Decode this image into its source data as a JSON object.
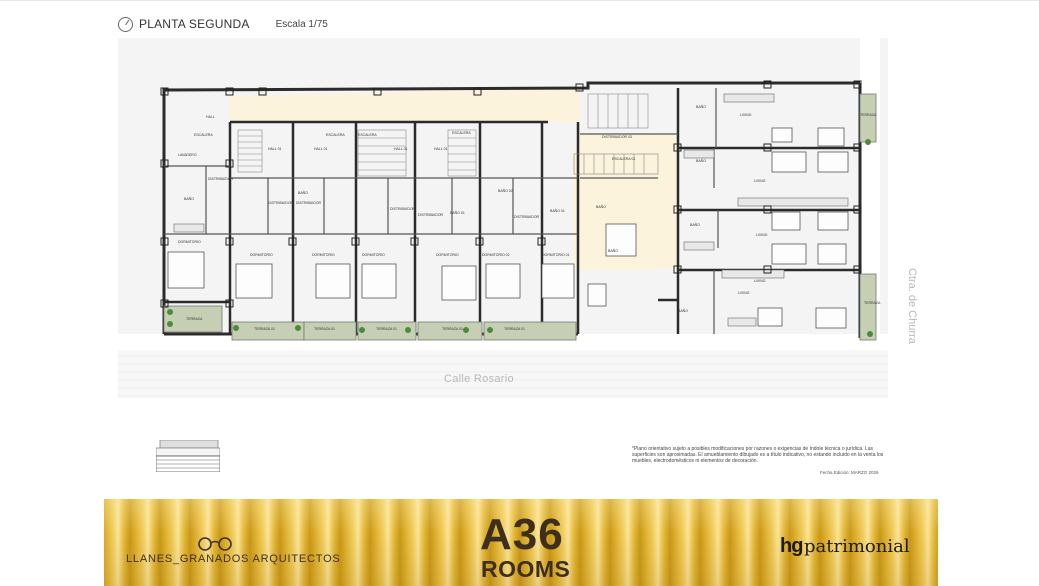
{
  "header": {
    "plan_title": "PLANTA SEGUNDA",
    "scale": "Escala 1/75"
  },
  "plan": {
    "street_label": "Calle Rosario",
    "road_label": "Ctra. de Churra",
    "rooms": [
      {
        "label": "HALL"
      },
      {
        "label": "ESCALERA"
      },
      {
        "label": "LAVADERO"
      },
      {
        "label": "BAÑO"
      },
      {
        "label": "DISTRIBUIDOR"
      },
      {
        "label": "DORMITORIO"
      },
      {
        "label": "TERRAZA"
      },
      {
        "label": "HALL 01"
      },
      {
        "label": "DISTRIBUIDOR"
      },
      {
        "label": "DORMITORIO"
      },
      {
        "label": "TERRAZA 01"
      },
      {
        "label": "ESCALERA"
      },
      {
        "label": "HALL 01"
      },
      {
        "label": "BAÑO"
      },
      {
        "label": "DISTRIBUIDOR"
      },
      {
        "label": "DORMITORIO"
      },
      {
        "label": "TERRAZA 01"
      },
      {
        "label": "ESCALERA"
      },
      {
        "label": "HALL 01"
      },
      {
        "label": "DISTRIBUIDOR"
      },
      {
        "label": "DORMITORIO"
      },
      {
        "label": "TERRAZA 01"
      },
      {
        "label": "ESCALERA"
      },
      {
        "label": "HALL 01"
      },
      {
        "label": "DISTRIBUIDOR"
      },
      {
        "label": "BAÑO 01"
      },
      {
        "label": "DORMITORIO"
      },
      {
        "label": "TERRAZA 01"
      },
      {
        "label": "BAÑO 02"
      },
      {
        "label": "DISTRIBUIDOR"
      },
      {
        "label": "DORMITORIO 02"
      },
      {
        "label": "TERRAZA 01"
      },
      {
        "label": "BAÑO 01"
      },
      {
        "label": "DORMITORIO 01"
      },
      {
        "label": "DISTRIBUIDOR 03"
      },
      {
        "label": "ESCALERA 01"
      },
      {
        "label": "BAÑO"
      },
      {
        "label": "LIVING"
      },
      {
        "label": "BAÑO"
      },
      {
        "label": "BAÑO"
      },
      {
        "label": "LIVING"
      },
      {
        "label": "TERRAZA"
      },
      {
        "label": "BAÑO"
      },
      {
        "label": "LIVING"
      },
      {
        "label": "BAÑO"
      },
      {
        "label": "LIVING"
      },
      {
        "label": "BAÑO"
      },
      {
        "label": "LIVING"
      },
      {
        "label": "TERRAZA"
      }
    ]
  },
  "notes": {
    "disclaimer": "*Plano orientativo sujeto a posibles modificaciones por razones o exigencias de índole técnica o jurídica. Las superficies son aproximadas. El amueblamiento dibujado es a título indicativo, no estando incluido en la venta los muebles, electrodomésticos ni elementos de decoración.",
    "edition": "Fecha Edición: MARZO 2026"
  },
  "footer": {
    "architect": "LLANES_GRANADOS ARQUITECTOS",
    "brand_line1": "A36",
    "brand_line2": "ROOMS",
    "partner_mark": "hg",
    "partner_name": "patrimonial"
  },
  "colors": {
    "common_area": "#fbf3dc",
    "terrace": "#c6cfb4",
    "wall": "#2b2b2b",
    "banner_gold": "#e2b536",
    "brand_text": "#3d2f1c"
  }
}
